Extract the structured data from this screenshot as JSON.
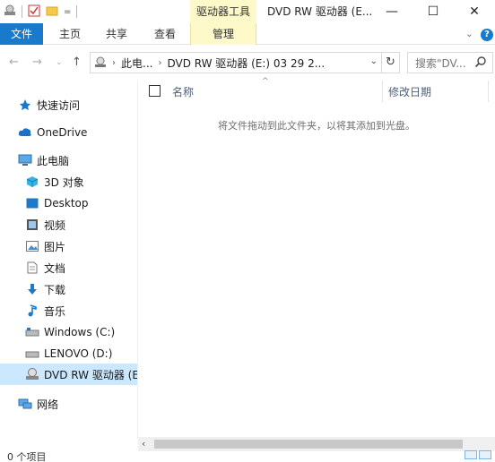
{
  "titlebar": {
    "context_group": "驱动器工具",
    "window_title": "DVD RW 驱动器 (E...",
    "controls": {
      "minimize": "—",
      "maximize": "☐",
      "close": "✕"
    }
  },
  "ribbon": {
    "tabs": [
      "文件",
      "主页",
      "共享",
      "查看",
      "管理"
    ],
    "help": "?"
  },
  "address": {
    "crumbs": [
      "此电...",
      "DVD RW 驱动器 (E:) 03 29 2..."
    ],
    "search_placeholder": "搜索\"DV..."
  },
  "navpane": {
    "items": [
      {
        "label": "快速访问",
        "icon": "star-icon"
      },
      {
        "label": "OneDrive",
        "icon": "cloud-icon"
      },
      {
        "label": "此电脑",
        "icon": "computer-icon"
      },
      {
        "label": "3D 对象",
        "icon": "cube-icon"
      },
      {
        "label": "Desktop",
        "icon": "desktop-icon"
      },
      {
        "label": "视频",
        "icon": "video-icon"
      },
      {
        "label": "图片",
        "icon": "picture-icon"
      },
      {
        "label": "文档",
        "icon": "document-icon"
      },
      {
        "label": "下载",
        "icon": "download-icon"
      },
      {
        "label": "音乐",
        "icon": "music-icon"
      },
      {
        "label": "Windows (C:)",
        "icon": "drive-icon"
      },
      {
        "label": "LENOVO (D:)",
        "icon": "drive-icon"
      },
      {
        "label": "DVD RW 驱动器 (E",
        "icon": "dvd-drive-icon"
      },
      {
        "label": "网络",
        "icon": "network-icon"
      }
    ]
  },
  "content": {
    "columns": [
      "名称",
      "修改日期"
    ],
    "empty_message": "将文件拖动到此文件夹，以将其添加到光盘。"
  },
  "statusbar": {
    "item_count": "0 个项目"
  },
  "colors": {
    "accent": "#1979ca",
    "context_tab": "#fef9c9",
    "selected": "#cce8ff"
  }
}
